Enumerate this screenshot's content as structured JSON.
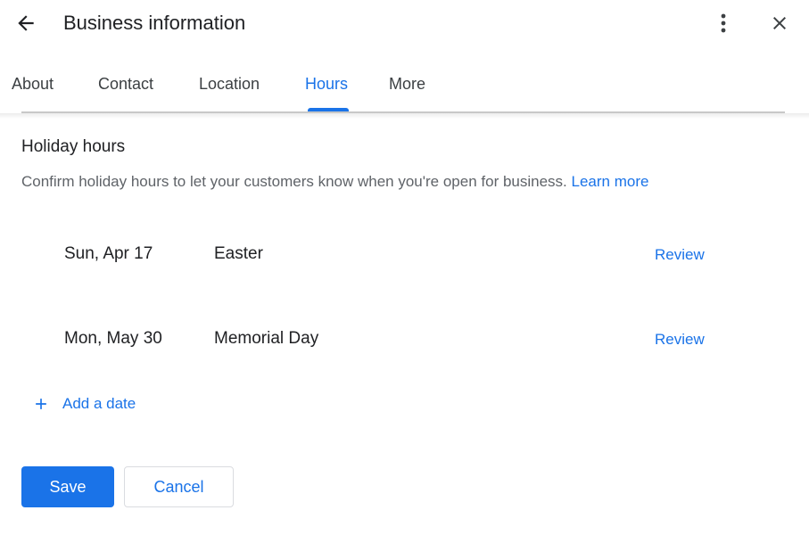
{
  "header": {
    "title": "Business information"
  },
  "tabs": [
    {
      "label": "About"
    },
    {
      "label": "Contact"
    },
    {
      "label": "Location"
    },
    {
      "label": "Hours"
    },
    {
      "label": "More"
    }
  ],
  "active_tab": "Hours",
  "section": {
    "title": "Holiday hours",
    "description": "Confirm holiday hours to let your customers know when you're open for business.",
    "learn_more": "Learn more"
  },
  "holidays": [
    {
      "date": "Sun, Apr 17",
      "name": "Easter",
      "action": "Review"
    },
    {
      "date": "Mon, May 30",
      "name": "Memorial Day",
      "action": "Review"
    }
  ],
  "add_date_label": "Add a date",
  "buttons": {
    "save": "Save",
    "cancel": "Cancel"
  },
  "colors": {
    "accent": "#1a73e8",
    "text": "#202124",
    "secondary": "#5f6368"
  }
}
